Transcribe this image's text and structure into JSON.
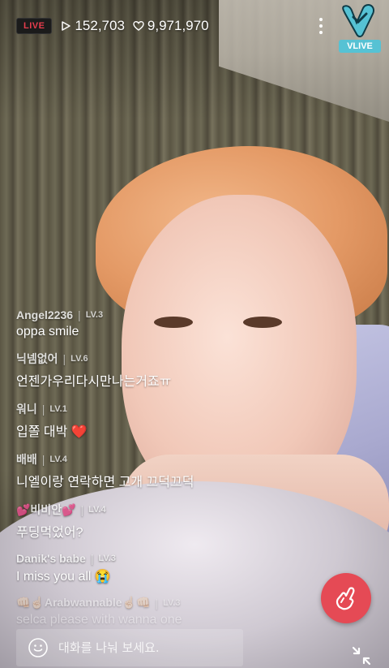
{
  "header": {
    "live_label": "LIVE",
    "views": "152,703",
    "likes": "9,971,970",
    "brand": "VLIVE"
  },
  "chat": {
    "messages": [
      {
        "user": "Angel2236",
        "level": "LV.3",
        "text": "oppa smile"
      },
      {
        "user": "닉넴없어",
        "level": "LV.6",
        "text": "언젠가우리다시만나는거죠ㅠ"
      },
      {
        "user": "워니",
        "level": "LV.1",
        "text": "입쫄 대박 ❤️"
      },
      {
        "user": "배배",
        "level": "LV.4",
        "text": "니엘이랑 연락하면 고개 끄덕끄덕"
      },
      {
        "user": "💕비비안💕",
        "level": "LV.4",
        "text": "푸딩먹었어?"
      },
      {
        "user": "Danik's babe",
        "level": "LV.3",
        "text": "I miss you all 😭"
      },
      {
        "user": "👊🏻☝🏻Arabwannable☝🏻👊🏻",
        "level": "LV.3",
        "text": "selca please with wanna one"
      }
    ]
  },
  "input": {
    "placeholder": "대화를 나눠 보세요."
  },
  "icons": {
    "heart_button": "finger-heart-icon",
    "emoji": "smiley-icon",
    "shrink": "shrink-arrows-icon",
    "menu": "more-vertical-icon",
    "views": "play-icon",
    "likes": "heart-outline-icon"
  },
  "colors": {
    "live_red": "#e83d4d",
    "heart_button": "#e54a55",
    "vlive_blue": "#56c2d4"
  }
}
